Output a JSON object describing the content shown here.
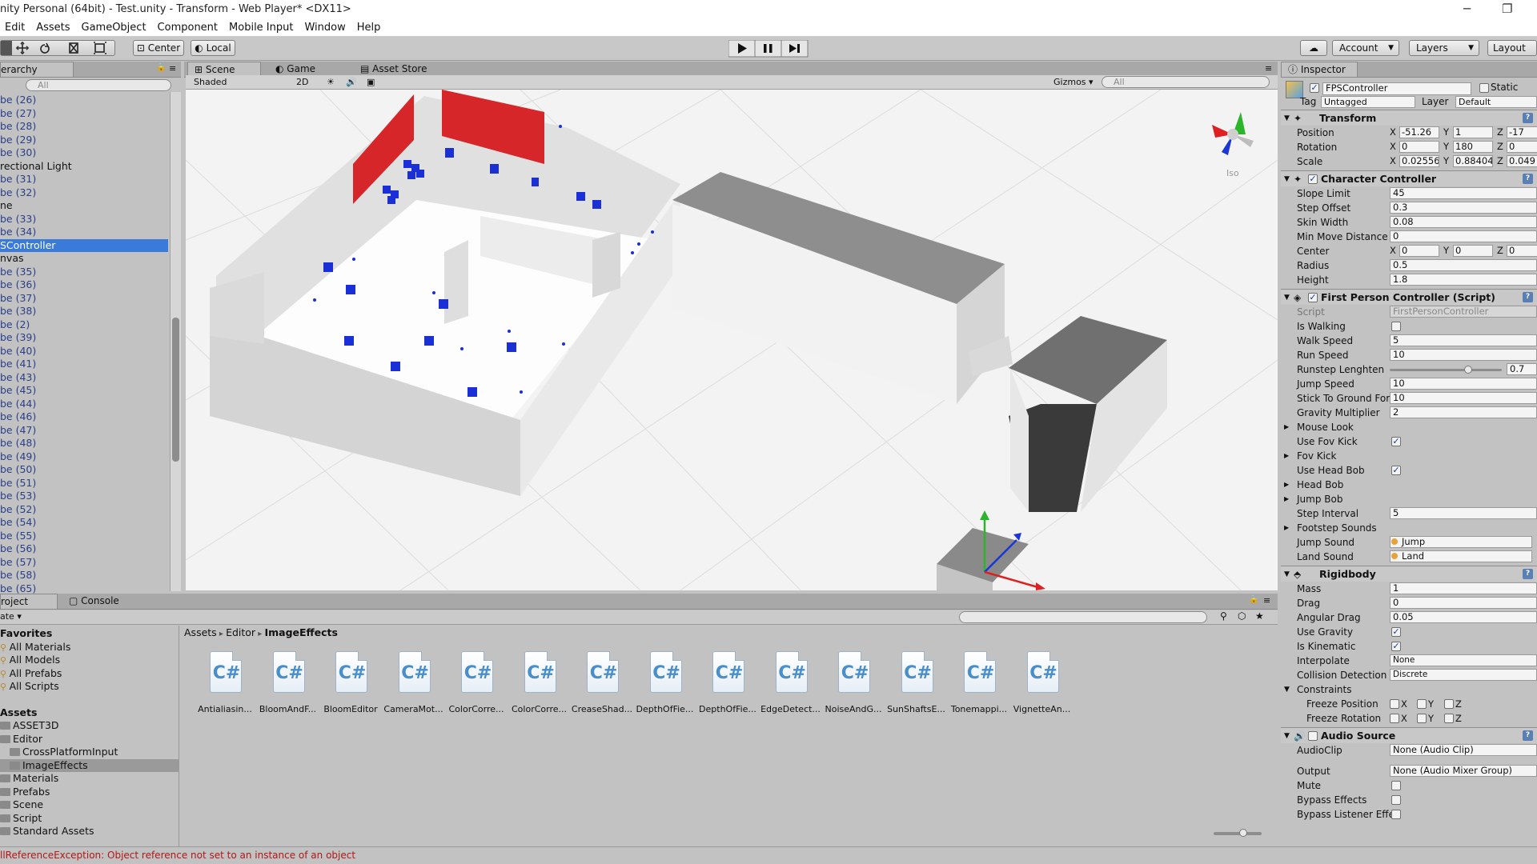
{
  "window": {
    "title": "nity Personal (64bit) - Test.unity - Transform - Web Player* <DX11>",
    "minimize": "─",
    "restore": "❐"
  },
  "menu": [
    "Edit",
    "Assets",
    "GameObject",
    "Component",
    "Mobile Input",
    "Window",
    "Help"
  ],
  "toolbar": {
    "center": "Center",
    "local": "Local",
    "account": "Account",
    "layers": "Layers",
    "layout": "Layout"
  },
  "hierarchy": {
    "tab": "erarchy",
    "search_placeholder": "All",
    "rows": [
      {
        "text": "be (26)",
        "type": "blue"
      },
      {
        "text": "be (27)",
        "type": "blue"
      },
      {
        "text": "be (28)",
        "type": "blue"
      },
      {
        "text": "be (29)",
        "type": "blue"
      },
      {
        "text": "be (30)",
        "type": "blue"
      },
      {
        "text": "rectional Light",
        "type": "plain"
      },
      {
        "text": "be (31)",
        "type": "blue"
      },
      {
        "text": "be (32)",
        "type": "blue"
      },
      {
        "text": "ne",
        "type": "plain"
      },
      {
        "text": "be (33)",
        "type": "blue"
      },
      {
        "text": "be (34)",
        "type": "blue"
      },
      {
        "text": "SController",
        "type": "sel"
      },
      {
        "text": "nvas",
        "type": "plain"
      },
      {
        "text": "be (35)",
        "type": "blue"
      },
      {
        "text": "be (36)",
        "type": "blue"
      },
      {
        "text": "be (37)",
        "type": "blue"
      },
      {
        "text": "be (38)",
        "type": "blue"
      },
      {
        "text": "be (2)",
        "type": "blue"
      },
      {
        "text": "be (39)",
        "type": "blue"
      },
      {
        "text": "be (40)",
        "type": "blue"
      },
      {
        "text": "be (41)",
        "type": "blue"
      },
      {
        "text": "be (43)",
        "type": "blue"
      },
      {
        "text": "be (45)",
        "type": "blue"
      },
      {
        "text": "be (44)",
        "type": "blue"
      },
      {
        "text": "be (46)",
        "type": "blue"
      },
      {
        "text": "be (47)",
        "type": "blue"
      },
      {
        "text": "be (48)",
        "type": "blue"
      },
      {
        "text": "be (49)",
        "type": "blue"
      },
      {
        "text": "be (50)",
        "type": "blue"
      },
      {
        "text": "be (51)",
        "type": "blue"
      },
      {
        "text": "be (53)",
        "type": "blue"
      },
      {
        "text": "be (52)",
        "type": "blue"
      },
      {
        "text": "be (54)",
        "type": "blue"
      },
      {
        "text": "be (55)",
        "type": "blue"
      },
      {
        "text": "be (56)",
        "type": "blue"
      },
      {
        "text": "be (57)",
        "type": "blue"
      },
      {
        "text": "be (58)",
        "type": "blue"
      },
      {
        "text": "be (65)",
        "type": "blue"
      }
    ]
  },
  "scene": {
    "tabs": [
      "Scene",
      "Game",
      "Asset Store"
    ],
    "shaded": "Shaded",
    "twod": "2D",
    "gizmos": "Gizmos",
    "search_placeholder": "All",
    "iso": "Iso"
  },
  "inspector": {
    "tab": "Inspector",
    "object_name": "FPSController",
    "static_label": "Static",
    "tag_label": "Tag",
    "tag_value": "Untagged",
    "layer_label": "Layer",
    "layer_value": "Default",
    "transform": {
      "title": "Transform",
      "position": {
        "label": "Position",
        "x": "-51.26",
        "y": "1",
        "z": "-17"
      },
      "rotation": {
        "label": "Rotation",
        "x": "0",
        "y": "180",
        "z": "0"
      },
      "scale": {
        "label": "Scale",
        "x": "0.02556",
        "y": "0.88404",
        "z": "0.049"
      }
    },
    "character_controller": {
      "title": "Character Controller",
      "slope_limit": {
        "label": "Slope Limit",
        "value": "45"
      },
      "step_offset": {
        "label": "Step Offset",
        "value": "0.3"
      },
      "skin_width": {
        "label": "Skin Width",
        "value": "0.08"
      },
      "min_move": {
        "label": "Min Move Distance",
        "value": "0"
      },
      "center": {
        "label": "Center",
        "x": "0",
        "y": "0",
        "z": "0"
      },
      "radius": {
        "label": "Radius",
        "value": "0.5"
      },
      "height": {
        "label": "Height",
        "value": "1.8"
      }
    },
    "fpc": {
      "title": "First Person Controller (Script)",
      "script": {
        "label": "Script",
        "value": "FirstPersonController"
      },
      "is_walking": "Is Walking",
      "walk_speed": {
        "label": "Walk Speed",
        "value": "5"
      },
      "run_speed": {
        "label": "Run Speed",
        "value": "10"
      },
      "runstep": {
        "label": "Runstep Lenghten",
        "value": "0.7",
        "fraction": 0.7
      },
      "jump_speed": {
        "label": "Jump Speed",
        "value": "10"
      },
      "stick": {
        "label": "Stick To Ground Forc",
        "value": "10"
      },
      "gravity_mult": {
        "label": "Gravity Multiplier",
        "value": "2"
      },
      "mouse_look": "Mouse Look",
      "use_fov_kick": "Use Fov Kick",
      "fov_kick": "Fov Kick",
      "use_head_bob": "Use Head Bob",
      "head_bob": "Head Bob",
      "jump_bob": "Jump Bob",
      "step_interval": {
        "label": "Step Interval",
        "value": "5"
      },
      "footstep": "Footstep Sounds",
      "jump_sound": {
        "label": "Jump Sound",
        "value": "Jump"
      },
      "land_sound": {
        "label": "Land Sound",
        "value": "Land"
      }
    },
    "rigidbody": {
      "title": "Rigidbody",
      "mass": {
        "label": "Mass",
        "value": "1"
      },
      "drag": {
        "label": "Drag",
        "value": "0"
      },
      "angular_drag": {
        "label": "Angular Drag",
        "value": "0.05"
      },
      "use_gravity": "Use Gravity",
      "is_kinematic": "Is Kinematic",
      "interpolate": {
        "label": "Interpolate",
        "value": "None"
      },
      "collision": {
        "label": "Collision Detection",
        "value": "Discrete"
      },
      "constraints": "Constraints",
      "freeze_pos": "Freeze Position",
      "freeze_rot": "Freeze Rotation",
      "x": "X",
      "y": "Y",
      "z": "Z"
    },
    "audio": {
      "title": "Audio Source",
      "clip": {
        "label": "AudioClip",
        "value": "None (Audio Clip)"
      },
      "output": {
        "label": "Output",
        "value": "None (Audio Mixer Group)"
      },
      "mute": "Mute",
      "bypass": "Bypass Effects",
      "bypass_listener": "Bypass Listener Effe"
    }
  },
  "project": {
    "tab": "roject",
    "console": "Console",
    "create": "ate",
    "favorites_title": "Favorites",
    "favorites": [
      "All Materials",
      "All Models",
      "All Prefabs",
      "All Scripts"
    ],
    "assets_title": "Assets",
    "tree": [
      {
        "text": "ASSET3D",
        "indent": 0
      },
      {
        "text": "Editor",
        "indent": 0
      },
      {
        "text": "CrossPlatformInput",
        "indent": 1
      },
      {
        "text": "ImageEffects",
        "indent": 1,
        "sel": true
      },
      {
        "text": "Materials",
        "indent": 0
      },
      {
        "text": "Prefabs",
        "indent": 0
      },
      {
        "text": "Scene",
        "indent": 0
      },
      {
        "text": "Script",
        "indent": 0
      },
      {
        "text": "Standard Assets",
        "indent": 0
      }
    ],
    "breadcrumb": [
      "Assets",
      "Editor",
      "ImageEffects"
    ],
    "files": [
      "Antialiasin...",
      "BloomAndF...",
      "BloomEditor",
      "CameraMot...",
      "ColorCorre...",
      "ColorCorre...",
      "CreaseShad...",
      "DepthOfFie...",
      "DepthOfFie...",
      "EdgeDetect...",
      "NoiseAndG...",
      "SunShaftsE...",
      "Tonemappi...",
      "VignetteAn..."
    ],
    "cs_glyph": "C#"
  },
  "status": "llReferenceException: Object reference not set to an instance of an object",
  "colors": {
    "selection": "#3a7ad8",
    "wall_red": "#d6262a",
    "cube_blue": "#1a2fd6"
  }
}
